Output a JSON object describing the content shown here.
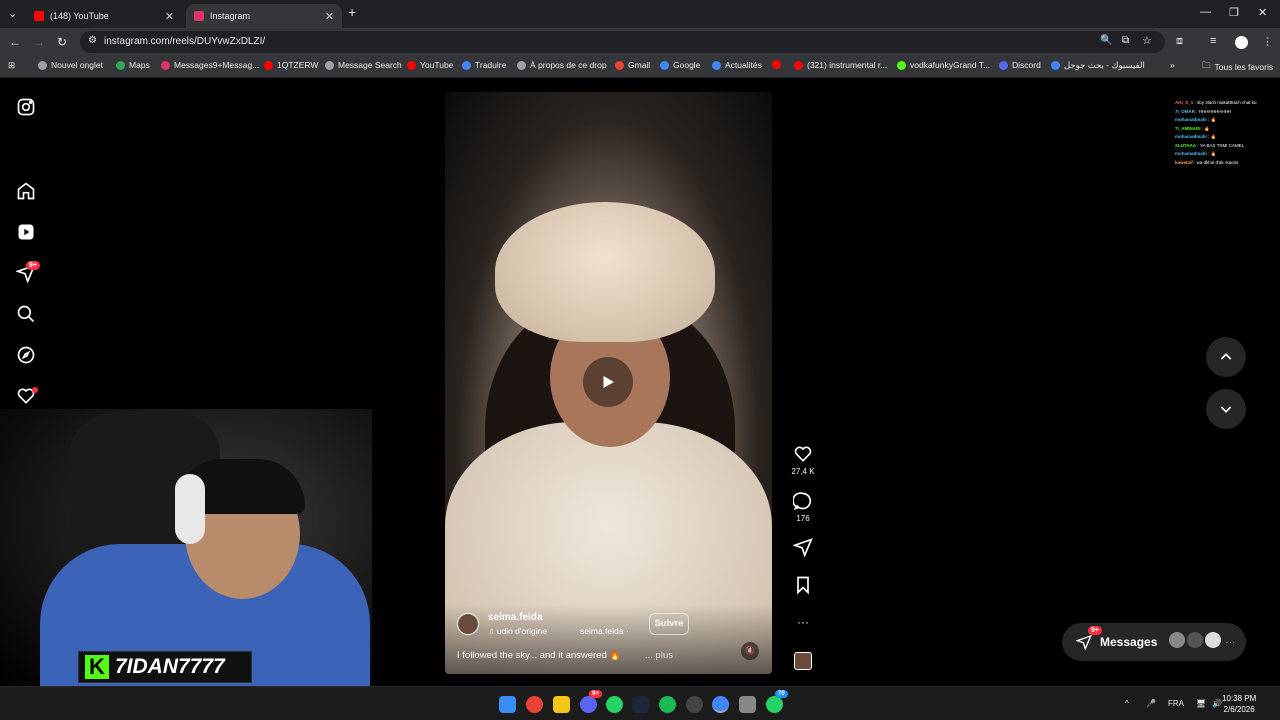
{
  "browser": {
    "tabs": [
      {
        "title": "(148) YouTube",
        "color": "#ff0000"
      },
      {
        "title": "Instagram",
        "color": "#e1306c"
      }
    ],
    "new_tab": "+",
    "url": "instagram.com/reels/DUYvwZxDLZI/"
  },
  "bookmarks": [
    {
      "label": "Nouvel onglet",
      "color": "#9aa0a6"
    },
    {
      "label": "Maps",
      "color": "#34a853"
    },
    {
      "label": "Messages9+Messag...",
      "color": "#e1306c"
    },
    {
      "label": "1QTZERW",
      "color": "#ff0000"
    },
    {
      "label": "Message Search",
      "color": "#9aa0a6"
    },
    {
      "label": "YouTube",
      "color": "#ff0000"
    },
    {
      "label": "Traduire",
      "color": "#4285f4"
    },
    {
      "label": "À propos de ce drop",
      "color": "#9aa0a6"
    },
    {
      "label": "Gmail",
      "color": "#ea4335"
    },
    {
      "label": "Google",
      "color": "#4285f4"
    },
    {
      "label": "Actualités",
      "color": "#4285f4"
    },
    {
      "label": "",
      "color": "#ff0000"
    },
    {
      "label": "(321) instrumental r...",
      "color": "#ff0000"
    },
    {
      "label": "vodkafunkyGrand T...",
      "color": "#53fc18"
    },
    {
      "label": "Discord",
      "color": "#5865f2"
    },
    {
      "label": "الفيسبوك - بحث جوجل",
      "color": "#4285f4"
    }
  ],
  "bookmarks_more": "»",
  "bookmarks_all": "Tous les favoris",
  "sidenav": {
    "notifications_badge": "9+"
  },
  "reel": {
    "username": "selma.feida",
    "audio": "udio d'origine",
    "audio_user": "selma.feida ·",
    "follow": "Suivre",
    "caption": "I followed the sky... and it answered 🔥",
    "more": "... plus",
    "likes": "27,4 K",
    "comments": "176",
    "options": "···"
  },
  "chat": [
    {
      "user": "AKI_S_1",
      "msg": "sby 3lach makat9rach chat ku",
      "color": "#ff6b6b"
    },
    {
      "user": "7I_OMAR",
      "msg": "HHHHHHHHHH",
      "color": "#4fc3f7"
    },
    {
      "user": "mohamadmahi",
      "msg": "🔥",
      "color": "#4fc3f7"
    },
    {
      "user": "7I_AMINADI",
      "msg": "🔥",
      "color": "#53fc18"
    },
    {
      "user": "mohamadmahi",
      "msg": "🔥",
      "color": "#4fc3f7"
    },
    {
      "user": "XLUTAAA",
      "msg": "YA BAX TXMI CAMEL",
      "color": "#53fc18"
    },
    {
      "user": "mohamadmahi",
      "msg": "🔥",
      "color": "#4fc3f7"
    },
    {
      "user": "kawetaif",
      "msg": "wa dkhol d'ak -kaoris",
      "color": "#ff9f43"
    }
  ],
  "streamer": {
    "name": "7IDAN7777"
  },
  "messages": {
    "label": "Messages",
    "badge": "9+",
    "more": "···"
  },
  "taskbar": {
    "lang": "FRA",
    "time": "10:38 PM",
    "date": "2/6/2026",
    "discord_badge": "9+",
    "whatsapp_badge": "70",
    "chevron": "^"
  }
}
